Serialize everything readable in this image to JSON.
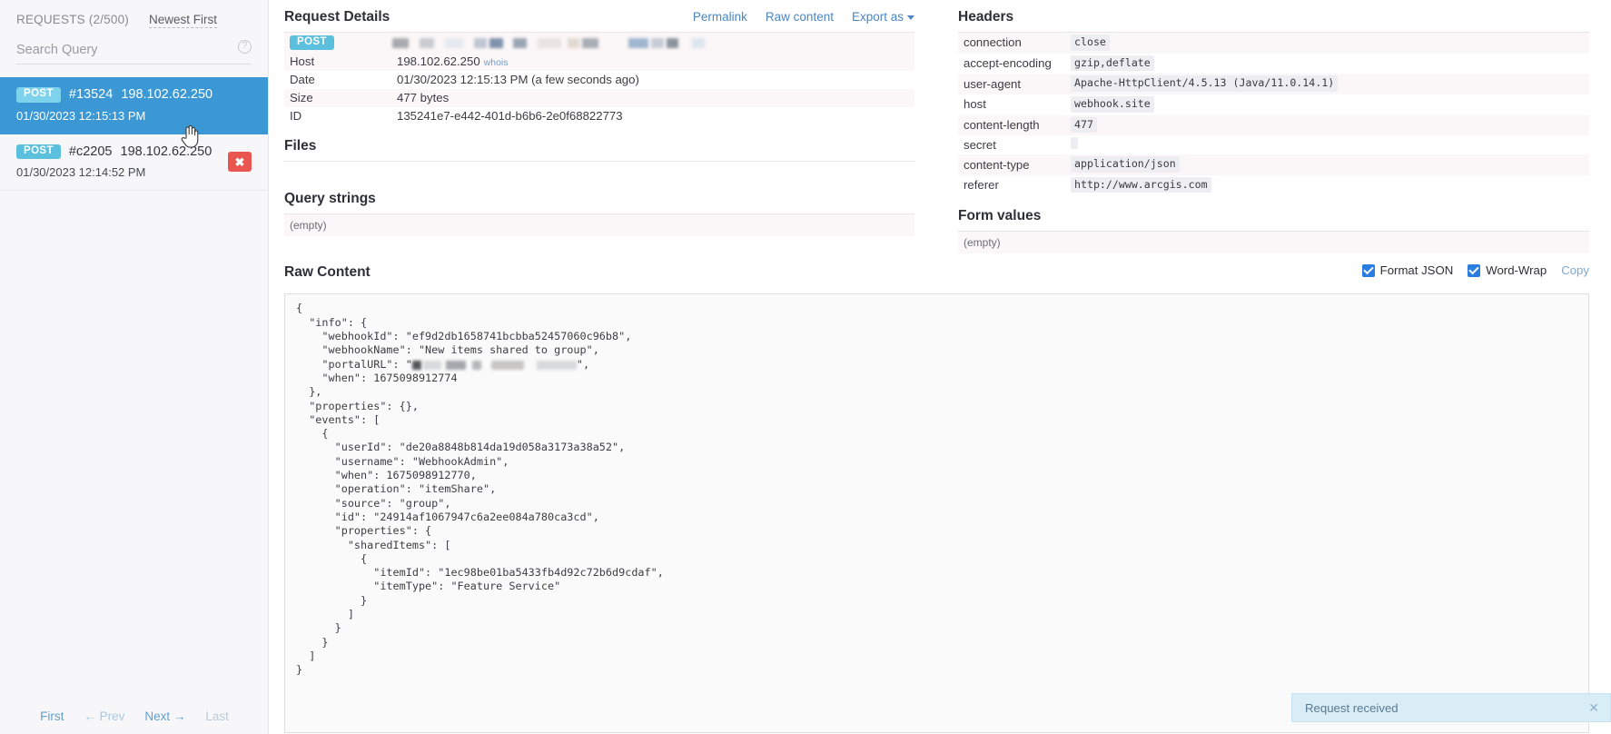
{
  "sidebar": {
    "requests_count_label": "REQUESTS (2/500)",
    "sort_label": "Newest First",
    "search_placeholder": "Search Query",
    "search_value": "",
    "help_icon_glyph": "?",
    "requests": [
      {
        "method": "POST",
        "id_label": "#13524",
        "ip": "198.102.62.250",
        "timestamp": "01/30/2023 12:15:13 PM",
        "selected": true
      },
      {
        "method": "POST",
        "id_label": "#c2205",
        "ip": "198.102.62.250",
        "timestamp": "01/30/2023 12:14:52 PM",
        "selected": false
      }
    ],
    "pager": {
      "first": "First",
      "prev": "← Prev",
      "next": "Next →",
      "last": "Last"
    },
    "delete_button_glyph": "✖"
  },
  "request_details": {
    "title": "Request Details",
    "actions": {
      "permalink": "Permalink",
      "raw_content": "Raw content",
      "export_as": "Export as"
    },
    "method_badge": "POST",
    "url_redacted": true,
    "rows": [
      {
        "key": "Host",
        "value": "198.102.62.250",
        "suffix_link": "whois"
      },
      {
        "key": "Date",
        "value": "01/30/2023 12:15:13 PM (a few seconds ago)"
      },
      {
        "key": "Size",
        "value": "477 bytes"
      },
      {
        "key": "ID",
        "value": "135241e7-e442-401d-b6b6-2e0f68822773"
      }
    ]
  },
  "files": {
    "title": "Files",
    "empty_text": ""
  },
  "query_strings": {
    "title": "Query strings",
    "empty_text": "(empty)"
  },
  "headers": {
    "title": "Headers",
    "rows": [
      {
        "key": "connection",
        "value": "close"
      },
      {
        "key": "accept-encoding",
        "value": "gzip,deflate"
      },
      {
        "key": "user-agent",
        "value": "Apache-HttpClient/4.5.13 (Java/11.0.14.1)"
      },
      {
        "key": "host",
        "value": "webhook.site"
      },
      {
        "key": "content-length",
        "value": "477"
      },
      {
        "key": "secret",
        "value": ""
      },
      {
        "key": "content-type",
        "value": "application/json"
      },
      {
        "key": "referer",
        "value": "http://www.arcgis.com"
      }
    ]
  },
  "form_values": {
    "title": "Form values",
    "empty_text": "(empty)"
  },
  "raw_content": {
    "title": "Raw Content",
    "format_json_label": "Format JSON",
    "format_json_checked": true,
    "word_wrap_label": "Word-Wrap",
    "word_wrap_checked": true,
    "copy_label": "Copy",
    "body_before_redaction": "{\n  \"info\": {\n    \"webhookId\": \"ef9d2db1658741bcbba52457060c96b8\",\n    \"webhookName\": \"New items shared to group\",\n    \"portalURL\": \"",
    "body_after_redaction": "\",\n    \"when\": 1675098912774\n  },\n  \"properties\": {},\n  \"events\": [\n    {\n      \"userId\": \"de20a8848b814da19d058a3173a38a52\",\n      \"username\": \"WebhookAdmin\",\n      \"when\": 1675098912770,\n      \"operation\": \"itemShare\",\n      \"source\": \"group\",\n      \"id\": \"24914af1067947c6a2ee084a780ca3cd\",\n      \"properties\": {\n        \"sharedItems\": [\n          {\n            \"itemId\": \"1ec98be01ba5433fb4d92c72b6d9cdaf\",\n            \"itemType\": \"Feature Service\"\n          }\n        ]\n      }\n    }\n  ]\n}"
  },
  "toast": {
    "message": "Request received",
    "close_glyph": "✕"
  },
  "colors": {
    "selected_row": "#3b98d4",
    "method_badge": "#5bc0de",
    "link": "#4a87c4",
    "delete": "#e8564f",
    "checkbox": "#2a7de1",
    "toast_bg": "#d9edf7"
  }
}
